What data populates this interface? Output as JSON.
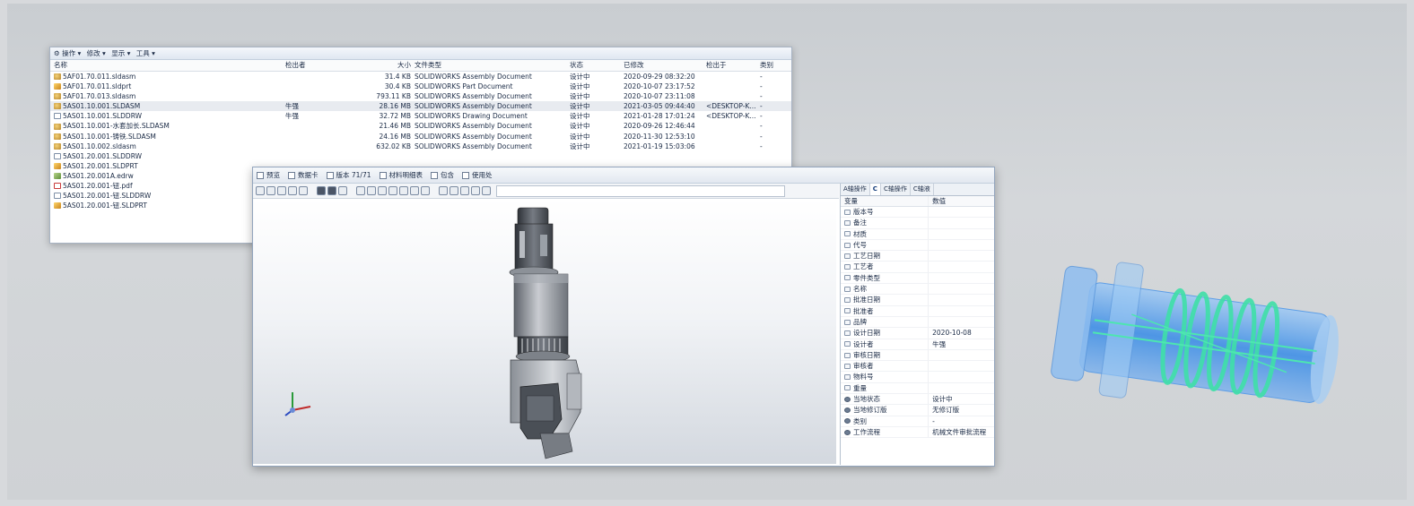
{
  "file_window": {
    "menu": [
      "⚙ 操作 ▾",
      "修改 ▾",
      "显示 ▾",
      "工具 ▾"
    ],
    "columns": {
      "name": "名称",
      "checked_out_by": "检出者",
      "size": "大小",
      "type": "文件类型",
      "state": "状态",
      "modified": "已修改",
      "checked_out_to": "检出于",
      "category": "类别"
    },
    "rows": [
      {
        "icon": "asm",
        "name": "5AF01.70.011.sldasm",
        "by": "",
        "size": "31.4 KB",
        "type": "SOLIDWORKS Assembly Document",
        "state": "设计中",
        "mod": "2020-09-29 08:32:20",
        "to": "",
        "cat": "-"
      },
      {
        "icon": "prt",
        "name": "5AF01.70.011.sldprt",
        "by": "",
        "size": "30.4 KB",
        "type": "SOLIDWORKS Part Document",
        "state": "设计中",
        "mod": "2020-10-07 23:17:52",
        "to": "",
        "cat": "-"
      },
      {
        "icon": "asm",
        "name": "5AF01.70.013.sldasm",
        "by": "",
        "size": "793.11 KB",
        "type": "SOLIDWORKS Assembly Document",
        "state": "设计中",
        "mod": "2020-10-07 23:11:08",
        "to": "",
        "cat": "-"
      },
      {
        "icon": "asm",
        "name": "5AS01.10.001.SLDASM",
        "by": "牛强",
        "size": "28.16 MB",
        "type": "SOLIDWORKS Assembly Document",
        "state": "设计中",
        "mod": "2021-03-05 09:44:40",
        "to": "<DESKTOP-K...",
        "cat": "-",
        "selected": true
      },
      {
        "icon": "drw",
        "name": "5AS01.10.001.SLDDRW",
        "by": "牛强",
        "size": "32.72 MB",
        "type": "SOLIDWORKS Drawing Document",
        "state": "设计中",
        "mod": "2021-01-28 17:01:24",
        "to": "<DESKTOP-K...",
        "cat": "-"
      },
      {
        "icon": "asm",
        "name": "5AS01.10.001-水套加长.SLDASM",
        "by": "",
        "size": "21.46 MB",
        "type": "SOLIDWORKS Assembly Document",
        "state": "设计中",
        "mod": "2020-09-26 12:46:44",
        "to": "",
        "cat": "-"
      },
      {
        "icon": "asm",
        "name": "5AS01.10.001-铸铁.SLDASM",
        "by": "",
        "size": "24.16 MB",
        "type": "SOLIDWORKS Assembly Document",
        "state": "设计中",
        "mod": "2020-11-30 12:53:10",
        "to": "",
        "cat": "-"
      },
      {
        "icon": "asm",
        "name": "5AS01.10.002.sldasm",
        "by": "",
        "size": "632.02 KB",
        "type": "SOLIDWORKS Assembly Document",
        "state": "设计中",
        "mod": "2021-01-19 15:03:06",
        "to": "",
        "cat": "-"
      },
      {
        "icon": "drw",
        "name": "5AS01.20.001.SLDDRW",
        "by": "",
        "size": "",
        "type": "",
        "state": "",
        "mod": "",
        "to": "",
        "cat": ""
      },
      {
        "icon": "prt",
        "name": "5AS01.20.001.SLDPRT",
        "by": "",
        "size": "",
        "type": "",
        "state": "",
        "mod": "",
        "to": "",
        "cat": ""
      },
      {
        "icon": "edrw",
        "name": "5AS01.20.001A.edrw",
        "by": "",
        "size": "",
        "type": "",
        "state": "",
        "mod": "",
        "to": "",
        "cat": ""
      },
      {
        "icon": "pdf",
        "name": "5AS01.20.001-钮.pdf",
        "by": "",
        "size": "",
        "type": "",
        "state": "",
        "mod": "",
        "to": "",
        "cat": ""
      },
      {
        "icon": "drw",
        "name": "5AS01.20.001-钮.SLDDRW",
        "by": "",
        "size": "",
        "type": "",
        "state": "",
        "mod": "",
        "to": "",
        "cat": ""
      },
      {
        "icon": "prt",
        "name": "5AS01.20.001-钮.SLDPRT",
        "by": "",
        "size": "",
        "type": "",
        "state": "",
        "mod": "",
        "to": "",
        "cat": ""
      }
    ]
  },
  "preview_window": {
    "tabs": [
      "预览",
      "数据卡",
      "版本 71/71",
      "材料明细表",
      "包含",
      "使用处"
    ],
    "props_tabs": [
      "A轴操作",
      "C",
      "C轴操作",
      "C轴液"
    ],
    "props_header": {
      "var": "变量",
      "val": "数值"
    },
    "props": [
      {
        "k": "版本号",
        "v": ""
      },
      {
        "k": "备注",
        "v": ""
      },
      {
        "k": "材质",
        "v": ""
      },
      {
        "k": "代号",
        "v": ""
      },
      {
        "k": "工艺日期",
        "v": ""
      },
      {
        "k": "工艺者",
        "v": ""
      },
      {
        "k": "零件类型",
        "v": ""
      },
      {
        "k": "名称",
        "v": ""
      },
      {
        "k": "批准日期",
        "v": ""
      },
      {
        "k": "批准者",
        "v": ""
      },
      {
        "k": "品牌",
        "v": ""
      },
      {
        "k": "设计日期",
        "v": "2020-10-08"
      },
      {
        "k": "设计者",
        "v": "牛强"
      },
      {
        "k": "审核日期",
        "v": ""
      },
      {
        "k": "审核者",
        "v": ""
      },
      {
        "k": "物料号",
        "v": ""
      },
      {
        "k": "重量",
        "v": ""
      },
      {
        "k": "当地状态",
        "v": "设计中",
        "gear": true
      },
      {
        "k": "当地修订版",
        "v": "无修订版",
        "gear": true
      },
      {
        "k": "类别",
        "v": "-",
        "gear": true
      },
      {
        "k": "工作流程",
        "v": "机械文件审批流程",
        "gear": true
      }
    ]
  },
  "colors": {
    "accent": "#2e62b8",
    "cylinder": "#4fa3f0",
    "coil": "#3fe0a8"
  }
}
